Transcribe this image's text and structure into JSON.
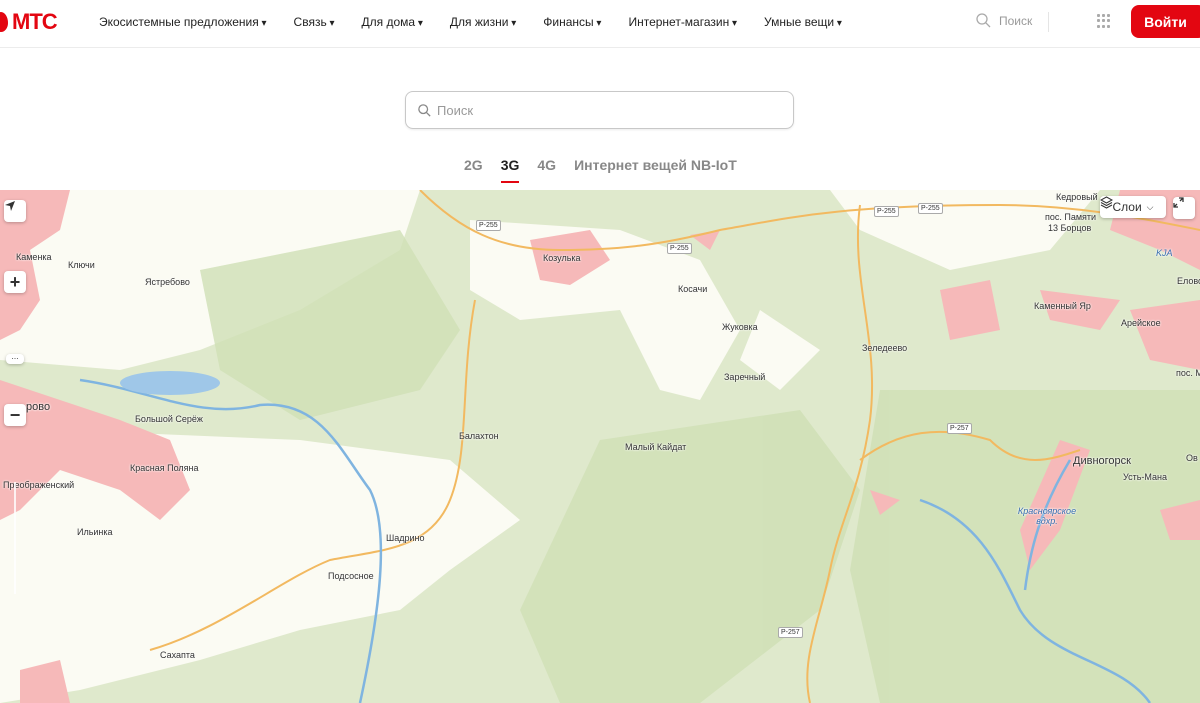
{
  "header": {
    "logo": "МТС",
    "nav": [
      "Экосистемные предложения",
      "Связь",
      "Для дома",
      "Для жизни",
      "Финансы",
      "Интернет-магазин",
      "Умные вещи"
    ],
    "search_label": "Поиск",
    "login": "Войти"
  },
  "search": {
    "placeholder": "Поиск"
  },
  "tabs": [
    {
      "label": "2G"
    },
    {
      "label": "3G",
      "active": true
    },
    {
      "label": "4G"
    },
    {
      "label": "Интернет вещей NB-IoT"
    }
  ],
  "map": {
    "layers_button": "Слои",
    "places": [
      "Кедровый",
      "пос. Памяти",
      "13 Борцов",
      "KJA",
      "Еловое",
      "Каменный Яр",
      "Арейское",
      "пос. Ми",
      "Каменка",
      "Ключи",
      "Ястребово",
      "Козулька",
      "Косачи",
      "Жуковка",
      "Зеледеево",
      "Заречный",
      "Малый Кайдат",
      "Балахтон",
      "Большой Серёж",
      "рово",
      "Красная Поляна",
      "Преображенский",
      "Ильинка",
      "Шадрино",
      "Подсосное",
      "Сахапта",
      "Дивногорск",
      "Ов",
      "Усть-Мана",
      "Красноярское вдхр."
    ],
    "roads": [
      "Р-255",
      "Р-255",
      "Р-255",
      "Р-255",
      "Р-257",
      "Р-257"
    ]
  }
}
